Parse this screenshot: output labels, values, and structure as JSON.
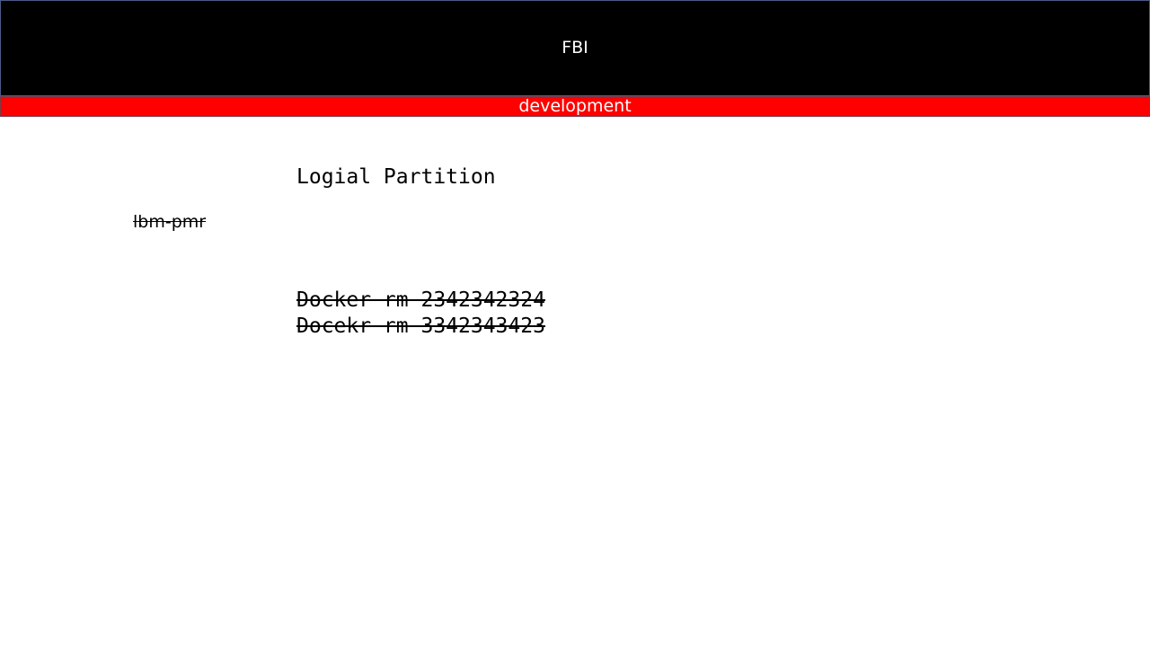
{
  "header": {
    "title": "FBI"
  },
  "environment": {
    "label": "development"
  },
  "content": {
    "section_title": "Logial Partition",
    "side_label": "lbm-pmr",
    "commands": [
      "Docker rm 2342342324",
      "Docekr rm 3342343423"
    ]
  },
  "colors": {
    "header_bg": "#000000",
    "banner_bg": "#ff0000",
    "text": "#000000"
  }
}
